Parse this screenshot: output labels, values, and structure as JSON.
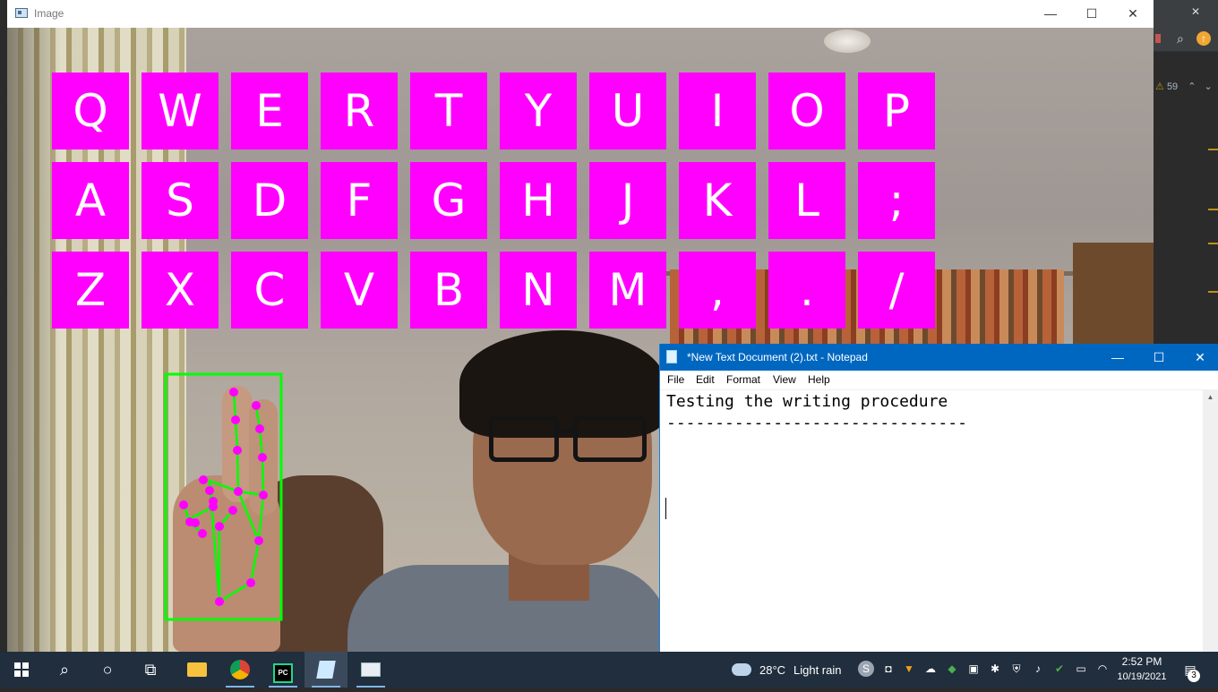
{
  "image_window": {
    "title": "Image",
    "minimize_glyph": "—",
    "maximize_glyph": "☐",
    "close_glyph": "✕"
  },
  "keyboard": {
    "key_color": "#ff00ff",
    "rows": [
      [
        "Q",
        "W",
        "E",
        "R",
        "T",
        "Y",
        "U",
        "I",
        "O",
        "P"
      ],
      [
        "A",
        "S",
        "D",
        "F",
        "G",
        "H",
        "J",
        "K",
        "L",
        ";"
      ],
      [
        "Z",
        "X",
        "C",
        "V",
        "B",
        "N",
        "M",
        ",",
        ".",
        "/"
      ]
    ]
  },
  "hand_tracking": {
    "box_color": "#00ff00",
    "landmark_color": "#ff00ff"
  },
  "background_ide": {
    "warning_count": "59"
  },
  "notepad": {
    "title": "*New Text Document (2).txt - Notepad",
    "menu": [
      "File",
      "Edit",
      "Format",
      "View",
      "Help"
    ],
    "lines": [
      "Testing the writing procedure",
      "-------------------------------"
    ],
    "titlebar_color": "#0067c0"
  },
  "taskbar": {
    "weather_temp": "28°C",
    "weather_text": "Light rain",
    "time": "2:52 PM",
    "date": "10/19/2021",
    "notification_count": "3"
  }
}
